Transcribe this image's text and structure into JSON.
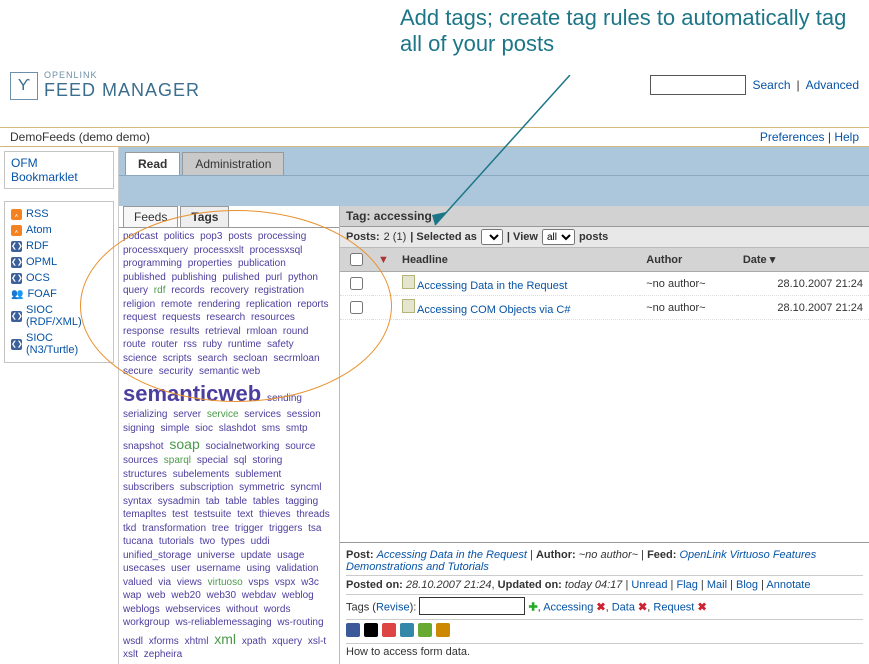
{
  "annotation": "Add tags; create tag rules to automatically tag all of your posts",
  "logo": {
    "brand": "OPENLINK",
    "product": "FEED MANAGER"
  },
  "search": {
    "link": "Search",
    "advanced": "Advanced",
    "placeholder": ""
  },
  "subheader": {
    "left": "DemoFeeds (demo demo)",
    "prefs": "Preferences",
    "help": "Help"
  },
  "sidebar": {
    "bookmarklet": "OFM Bookmarklet",
    "feeds": [
      {
        "label": "RSS",
        "icon": "feed"
      },
      {
        "label": "Atom",
        "icon": "feed"
      },
      {
        "label": "RDF",
        "icon": "rdf"
      },
      {
        "label": "OPML",
        "icon": "rdf"
      },
      {
        "label": "OCS",
        "icon": "rdf"
      },
      {
        "label": "FOAF",
        "icon": "foaf"
      },
      {
        "label": "SIOC (RDF/XML)",
        "icon": "rdf"
      },
      {
        "label": "SIOC (N3/Turtle)",
        "icon": "rdf"
      }
    ]
  },
  "tabs": {
    "read": "Read",
    "admin": "Administration"
  },
  "subtabs": {
    "feeds": "Feeds",
    "tags": "Tags"
  },
  "cloud": [
    "podcast",
    "politics",
    "pop3",
    "posts",
    "processing",
    "processxquery",
    "processxslt",
    "processxsql",
    "programming",
    "properties",
    "publication",
    "published",
    "publishing",
    "pulished",
    "purl",
    "python",
    "query",
    "rdf",
    "records",
    "recovery",
    "registration",
    "religion",
    "remote",
    "rendering",
    "replication",
    "reports",
    "request",
    "requests",
    "research",
    "resources",
    "response",
    "results",
    "retrieval",
    "rmloan",
    "round",
    "route",
    "router",
    "rss",
    "ruby",
    "runtime",
    "safety",
    "science",
    "scripts",
    "search",
    "secloan",
    "secrmloan",
    "secure",
    "security",
    "semantic web",
    "semanticweb",
    "sending",
    "serializing",
    "server",
    "service",
    "services",
    "session",
    "signing",
    "simple",
    "sioc",
    "slashdot",
    "sms",
    "smtp",
    "snapshot",
    "soap",
    "socialnetworking",
    "source",
    "sources",
    "sparql",
    "special",
    "sql",
    "storing",
    "structures",
    "subelements",
    "sublement",
    "subscribers",
    "subscription",
    "symmetric",
    "syncml",
    "syntax",
    "sysadmin",
    "tab",
    "table",
    "tables",
    "tagging",
    "temapltes",
    "test",
    "testsuite",
    "text",
    "thieves",
    "threads",
    "tkd",
    "transformation",
    "tree",
    "trigger",
    "triggers",
    "tsa",
    "tucana",
    "tutorials",
    "two",
    "types",
    "uddi",
    "unified_storage",
    "universe",
    "update",
    "usage",
    "usecases",
    "user",
    "username",
    "using",
    "validation",
    "valued",
    "via",
    "views",
    "virtuoso",
    "vsps",
    "vspx",
    "w3c",
    "wap",
    "web",
    "web20",
    "web30",
    "webdav",
    "weblog",
    "weblogs",
    "webservices",
    "without",
    "words",
    "workgroup",
    "ws-reliablemessaging",
    "ws-routing",
    "wsdl",
    "xforms",
    "xhtml",
    "xml",
    "xpath",
    "xquery",
    "xsl-t",
    "xslt",
    "zepheira"
  ],
  "cloud_styles": {
    "semanticweb": "big",
    "rdf": "g",
    "service": "g",
    "soap": "med g",
    "sparql": "g",
    "virtuoso": "g",
    "xml": "med g"
  },
  "right": {
    "tag_header": "Tag: accessing",
    "posts_label": "Posts:",
    "posts_count": "2 (1)",
    "selected_as": "| Selected as",
    "view": "| View",
    "view_opt": "all",
    "posts_suffix": "posts",
    "columns": {
      "headline": "Headline",
      "author": "Author",
      "date": "Date"
    },
    "rows": [
      {
        "title": "Accessing Data in the Request",
        "author": "~no author~",
        "date": "28.10.2007 21:24"
      },
      {
        "title": "Accessing COM Objects via C#",
        "author": "~no author~",
        "date": "28.10.2007 21:24"
      }
    ],
    "detail": {
      "post_lbl": "Post:",
      "post": "Accessing Data in the Request",
      "author_lbl": "Author:",
      "author": "~no author~",
      "feed_lbl": "Feed:",
      "feed": "OpenLink Virtuoso Features Demonstrations and Tutorials",
      "posted_lbl": "Posted on:",
      "posted": "28.10.2007 21:24",
      "updated_lbl": "Updated on:",
      "updated": "today 04:17",
      "links": {
        "unread": "Unread",
        "flag": "Flag",
        "mail": "Mail",
        "blog": "Blog",
        "annotate": "Annotate"
      },
      "tags_lbl": "Tags",
      "revise": "Revise",
      "tag_list": [
        "Accessing",
        "Data",
        "Request"
      ],
      "body": "How to access form data."
    }
  }
}
